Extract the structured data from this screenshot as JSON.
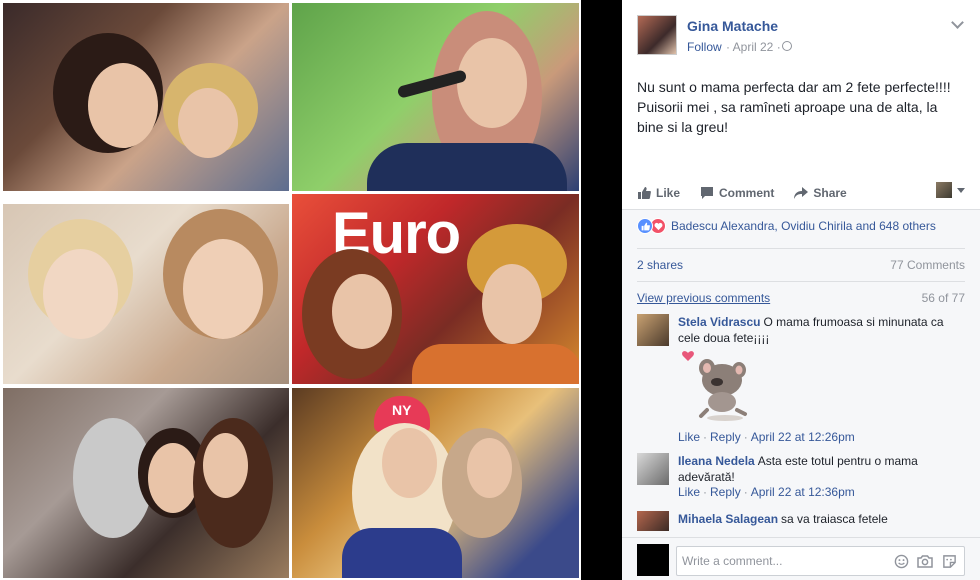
{
  "post": {
    "author": "Gina Matache",
    "follow_label": "Follow",
    "date": "· April 22 ·",
    "text": "Nu sunt o mama perfecta dar am 2 fete perfecte!!!! Puisorii mei , sa ramîneti aproape una de alta, la bine si la greu!",
    "photo_overlay_text": "Euro",
    "cap_logo": "NY"
  },
  "actions": {
    "like": "Like",
    "comment": "Comment",
    "share": "Share"
  },
  "reactions": {
    "names": "Badescu Alexandra, Ovidiu Chirila and 648 others",
    "shares": "2 shares",
    "comment_count": "77 Comments",
    "view_previous": "View previous comments",
    "pager": "56 of 77"
  },
  "comments": [
    {
      "name": "Stela Vidrascu",
      "text": "O mama frumoasa si minunata ca cele doua fete¡¡¡¡",
      "like": "Like",
      "reply": "Reply",
      "time": "April 22 at 12:26pm"
    },
    {
      "name": "Ileana Nedela",
      "text": "Asta este totul pentru o mama adevărată!",
      "like": "Like",
      "reply": "Reply",
      "time": "April 22 at 12:36pm"
    },
    {
      "name": "Mihaela Salagean",
      "text": "sa va traiasca fetele"
    }
  ],
  "composer": {
    "placeholder": "Write a comment..."
  },
  "colors": {
    "link": "#365899",
    "muted": "#90949c",
    "panel_bg": "#f6f7f9"
  }
}
